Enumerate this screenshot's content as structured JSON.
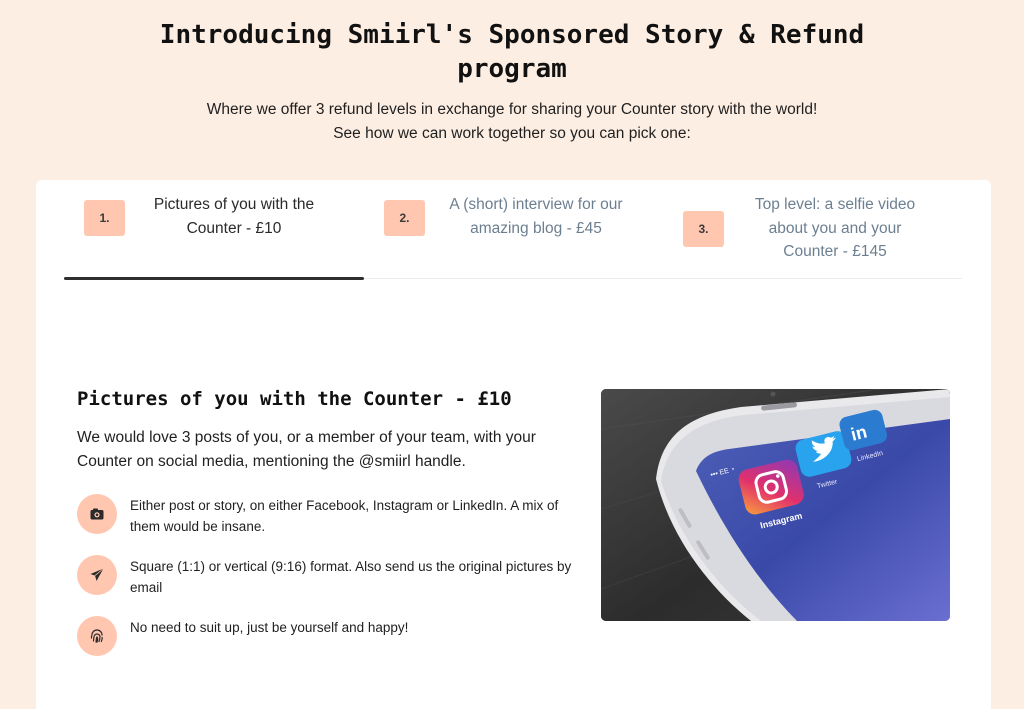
{
  "hero": {
    "title": "Introducing Smiirl's Sponsored Story & Refund program",
    "subtitle_line1": "Where we offer 3 refund levels in exchange for sharing your Counter story with the world!",
    "subtitle_line2": "See how we can work together so you can pick one:"
  },
  "tabs": [
    {
      "number": "1.",
      "line1": "Pictures of you with the",
      "line2": "Counter - £10",
      "line3": "",
      "active": true
    },
    {
      "number": "2.",
      "line1": "A (short) interview for our",
      "line2": "amazing blog - £45",
      "line3": "",
      "active": false
    },
    {
      "number": "3.",
      "line1": "Top level: a selfie video",
      "line2": "about you and your",
      "line3": "Counter - £145",
      "active": false
    }
  ],
  "content": {
    "title": "Pictures of you with the Counter - £10",
    "description": "We would love 3 posts of you, or a member of your team, with your Counter on social media, mentioning the @smiirl handle.",
    "features": [
      {
        "icon": "camera-icon",
        "text": "Either post or story, on either Facebook, Instagram or LinkedIn. A mix of them would be insane."
      },
      {
        "icon": "paper-plane-icon",
        "text": "Square (1:1) or vertical (9:16) format. Also send us the original pictures by email"
      },
      {
        "icon": "fingerprint-icon",
        "text": "No need to suit up, just be yourself and happy!"
      }
    ],
    "photo": {
      "carrier": "EE",
      "apps": [
        "Instagram",
        "Twitter",
        "LinkedIn"
      ]
    }
  },
  "colors": {
    "page_background": "#fdeee3",
    "accent_peach": "#ffc6b0",
    "inactive_tab_text": "#6c7f91",
    "active_tab_underline": "#2f2f2f"
  }
}
